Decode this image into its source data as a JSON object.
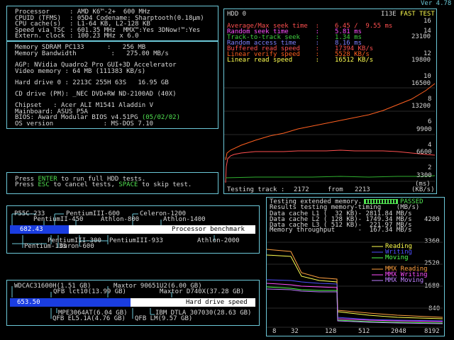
{
  "version": "Ver 4.78",
  "sysinfo": {
    "rows": [
      [
        "Processor",
        ": AMD K6™-2+  600 MHz"
      ],
      [
        "CPUID (TFMS)",
        ": 05D4 Codename: Sharptooth(0.18µm)"
      ],
      [
        "CPU cache(s)",
        ": L1-64 KB, L2-128 KB"
      ],
      [
        "Speed via TSC",
        ": 601.35 MHz  MMX™:Yes 3DNow!™:Yes"
      ],
      [
        "Extern. clock",
        ": 100.23 MHz x 6.0"
      ]
    ]
  },
  "hardware": {
    "memory_type": "Memory SDRAM PC133      :   256 MB",
    "memory_bw": "Memory Bandwidth         :   275.00 MB/s",
    "agp": "AGP: NVidia Quadro2 Pro GUI+3D Accelerator",
    "video_mem": "Video memory : 64 MB (111383 KB/s)",
    "hdd": "Hard drive 0 : 2213C 255H 63S   16.95 GB",
    "cd": "CD drive (PM): _NEC DVD+RW ND-2100AD (40X)",
    "chipset": "Chipset   : Acer ALI M1541 Aladdin V",
    "mainboard": "Mainboard: ASUS P5A",
    "bios_prefix": "BIOS: Award Modular BIOS v4.51PG ",
    "bios_date": "(05/02/02)",
    "os": "OS version             : MS-DOS 7.10"
  },
  "prompt": {
    "l1_a": "Press ",
    "l1_key": "ENTER",
    "l1_b": " to run full HDD tests.",
    "l2_a": "Press ",
    "l2_key": "ESC",
    "l2_b": " to cancel tests, ",
    "l2_key2": "SPACE",
    "l2_c": " to skip test."
  },
  "hdd_panel": {
    "title": "HDD 0",
    "model": "I13E",
    "mode": "FAST TEST",
    "stats": [
      {
        "label": "Average/Max seek time  :",
        "value": "6.45 /  9.55 ms",
        "color": "#ff5050"
      },
      {
        "label": "Random seek time       :",
        "value": "5.81 ms",
        "color": "#ff50ff"
      },
      {
        "label": "Track-to-track seek    :",
        "value": "1.34 ms",
        "color": "#40d040"
      },
      {
        "label": "Random access time     :",
        "value": "8.16 ms",
        "color": "#8080ff"
      },
      {
        "label": "Buffered read speed    :",
        "value": "17394 KB/s",
        "color": "#ff5050"
      },
      {
        "label": "Linear verify speed    :",
        "value": "5528 KB/s",
        "color": "#ff6020"
      },
      {
        "label": "Linear read speed      :",
        "value": "16512 KB/s",
        "color": "#ffff50"
      }
    ],
    "ms_axis": [
      "14",
      "12",
      "10",
      "8",
      "6",
      "4",
      "2"
    ],
    "ms_axis_top": "16",
    "kb_axis": [
      "23100",
      "19800",
      "16500",
      "13200",
      "9900",
      "6600",
      "3300"
    ],
    "unit_ms": "(ms)",
    "unit_kb": "(KB/s)",
    "track_label": "Testing track :",
    "track_cur": "2172",
    "track_from": "from",
    "track_total": "2213"
  },
  "mem_panel": {
    "l0_a": "Testing extended memory.",
    "l0_status": "PASSED",
    "l1": "Results testing memory-timing    (MB/s)",
    "l2": "Data cache L1 (  32 KB)- 2811.84 MB/s",
    "l3": "Data cache L2 ( 128 KB)- 1749.34 MB/s",
    "l4": "Data cache L3 ( 512 KB)-  221.97 MB/s",
    "l5": "Memory throughput      -  167.34 MB/s",
    "y_axis": [
      "4200",
      "3360",
      "2520",
      "1680",
      "840"
    ],
    "x_axis": [
      "8",
      "32",
      "128",
      "512",
      "2048",
      "8192"
    ],
    "legend": [
      {
        "label": "Reading",
        "color": "#ffff50"
      },
      {
        "label": "Writing",
        "color": "#5050ff"
      },
      {
        "label": "Moving",
        "color": "#50ff50"
      },
      {
        "label": "MMX Reading",
        "color": "#ffa040"
      },
      {
        "label": "MMX Writing",
        "color": "#ff50ff"
      },
      {
        "label": "MMX Moving",
        "color": "#c080ff"
      }
    ]
  },
  "cpu_bench": {
    "value": "682.43",
    "progress": 0.24,
    "label": "Processor benchmark",
    "top_labels": [
      "P55C-233",
      "PentiumIII-600",
      "Celeron-1200",
      "PentiumII-450",
      "Athlon-800",
      "Athlon-1400"
    ],
    "bottom_labels": [
      "PentiumIII-300",
      "PentiumIII-933",
      "Athlon-2000",
      "Pentium-133",
      "Duron-600"
    ]
  },
  "hdd_bench": {
    "value": "653.50",
    "progress": 0.49,
    "label": "Hard drive speed",
    "top_labels": [
      "WDCAC31600H(1.51 GB)",
      "Maxtor 90651U2(6.00 GB)",
      "QFB lct10(13.99 GB)",
      "Maxtor D740X(37.28 GB)"
    ],
    "bottom_labels": [
      "MPE3064AT(6.04 GB)",
      "IBM DTLA 307030(28.63 GB)",
      "QFB EL5.1A(4.76 GB)",
      "QFB LM(9.57 GB)"
    ]
  }
}
